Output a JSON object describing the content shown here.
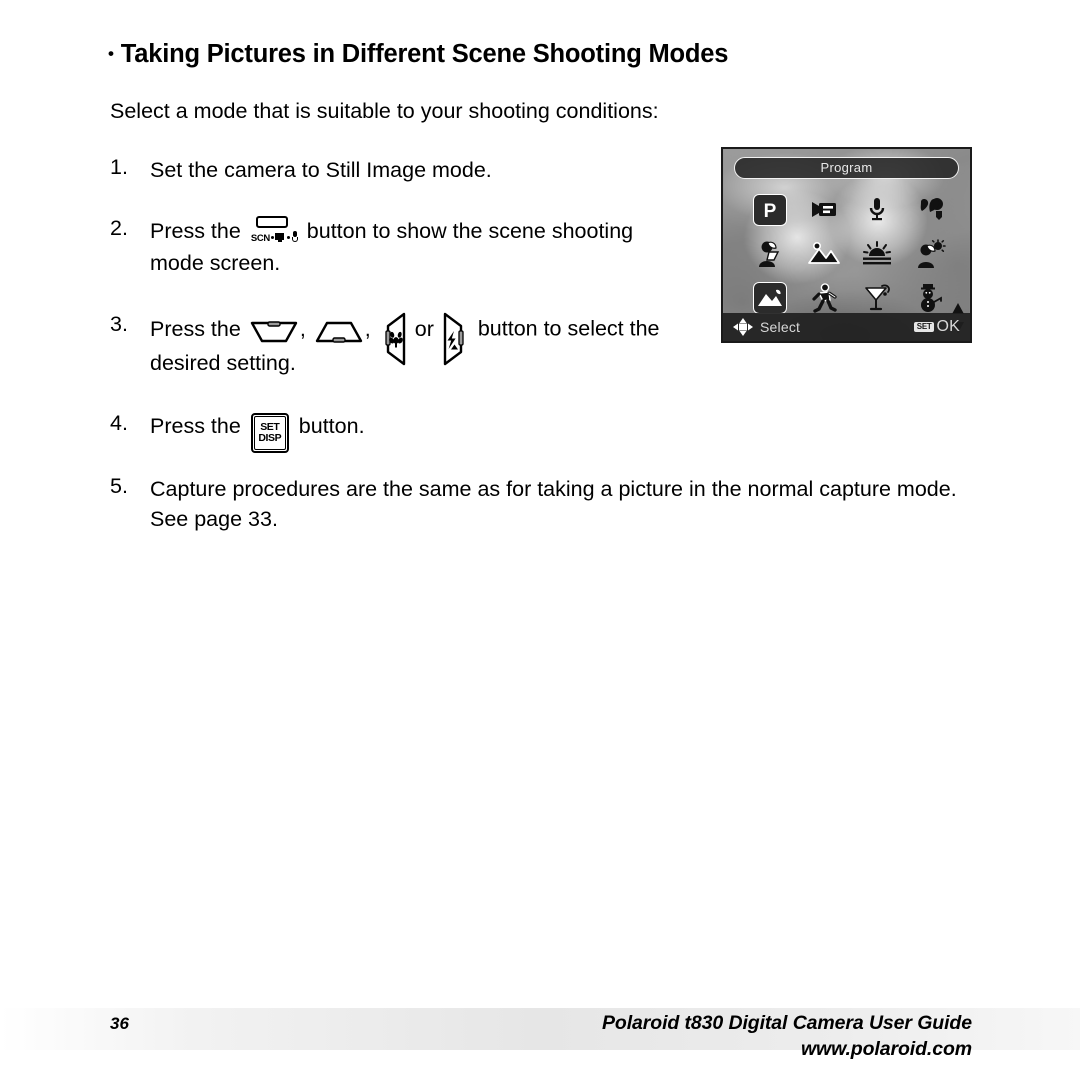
{
  "document": {
    "heading": "Taking Pictures in Different Scene Shooting Modes",
    "heading_bullet": "•",
    "intro": "Select a mode that is suitable to your shooting conditions:"
  },
  "steps": [
    {
      "number": "1.",
      "text": "Set the camera to Still Image mode."
    },
    {
      "number": "2.",
      "before": "Press the",
      "icon": "scn-movie-mic-button-icon",
      "after": "button to show the scene shooting mode screen."
    },
    {
      "number": "3.",
      "before": "Press the",
      "icons": [
        "zoom-out-button-icon",
        "zoom-in-button-icon",
        "macro-button-icon",
        "flash-button-icon"
      ],
      "separator": ",",
      "conjunction": "or",
      "after": "button to select the desired setting."
    },
    {
      "number": "4.",
      "before": "Press the",
      "icon": "set-disp-button-icon",
      "after": "button."
    },
    {
      "number": "5.",
      "text": "Capture procedures are the same as for taking a picture in the normal capture mode. See page 33."
    }
  ],
  "button_icons": {
    "scn": {
      "label": "SCN",
      "movie_glyph": "movie-camera",
      "mic_glyph": "microphone"
    },
    "set_disp": {
      "line1": "SET",
      "line2": "DISP"
    }
  },
  "lcd": {
    "title": "Program",
    "rows": [
      [
        {
          "name": "program-mode-icon",
          "glyph": "P",
          "selected": true
        },
        {
          "name": "movie-mode-icon",
          "glyph": "movie",
          "selected": false
        },
        {
          "name": "voice-recording-mode-icon",
          "glyph": "microphone",
          "selected": false
        },
        {
          "name": "portrait-mode-icon",
          "glyph": "portrait-head",
          "selected": false
        }
      ],
      [
        {
          "name": "night-portrait-mode-icon",
          "glyph": "person-night",
          "selected": false
        },
        {
          "name": "landscape-mode-icon",
          "glyph": "mountains",
          "selected": false
        },
        {
          "name": "sunset-mode-icon",
          "glyph": "sunset",
          "selected": false
        },
        {
          "name": "backlight-portrait-mode-icon",
          "glyph": "person-sun",
          "selected": false
        }
      ],
      [
        {
          "name": "night-scene-mode-icon",
          "glyph": "night-moon-mountain",
          "selected": true
        },
        {
          "name": "sport-mode-icon",
          "glyph": "runner",
          "selected": false
        },
        {
          "name": "party-mode-icon",
          "glyph": "party-glass",
          "selected": false
        },
        {
          "name": "snow-mode-icon",
          "glyph": "snowman",
          "selected": false
        }
      ]
    ],
    "scroll": {
      "up": "scroll-up-arrow-icon",
      "down": "scroll-down-arrow-icon"
    },
    "bottom_bar": {
      "select_label": "Select",
      "nav_icon": "four-way-pad-icon",
      "set_chip": "SET",
      "ok_label": "OK"
    }
  },
  "footer": {
    "page_number": "36",
    "guide_title": "Polaroid t830 Digital Camera User Guide",
    "website": "www.polaroid.com"
  },
  "colors": {
    "text": "#000000",
    "page_background": "#ffffff",
    "footer_band_mid": "#e6e6e6",
    "lcd_overlay": "#262626",
    "lcd_text": "#e8e8e8"
  }
}
